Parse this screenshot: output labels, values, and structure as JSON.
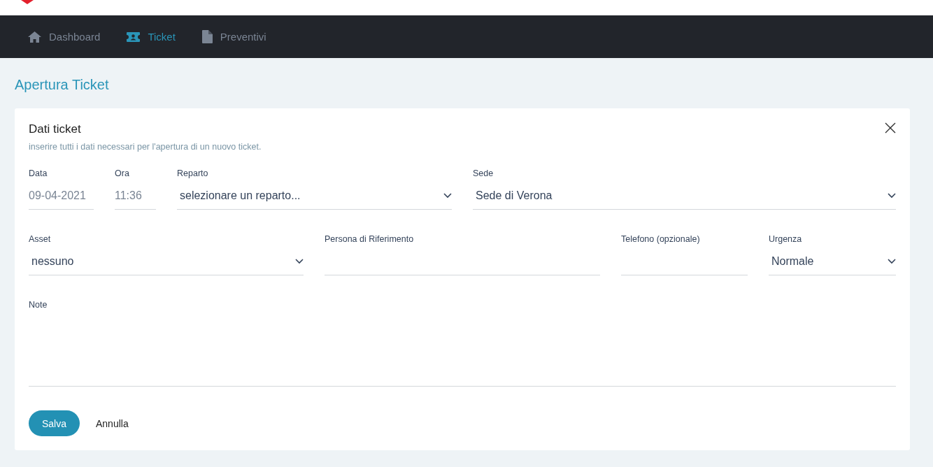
{
  "nav": [
    {
      "label": "Dashboard",
      "selected": false
    },
    {
      "label": "Ticket",
      "selected": true
    },
    {
      "label": "Preventivi",
      "selected": false
    }
  ],
  "page_title": "Apertura Ticket",
  "card": {
    "title": "Dati ticket",
    "subtitle": "inserire tutti i dati necessari per l'apertura di un nuovo ticket.",
    "rows": [
      [
        {
          "label": "Data",
          "kind": "text",
          "value": "09-04-2021",
          "readonly": true
        },
        {
          "label": "Ora",
          "kind": "text",
          "value": "11:36",
          "readonly": true
        },
        {
          "label": "Reparto",
          "kind": "select",
          "value": "selezionare un reparto..."
        },
        {
          "label": "Sede",
          "kind": "select",
          "value": "Sede di Verona"
        }
      ],
      [
        {
          "label": "Asset",
          "kind": "select",
          "value": "nessuno"
        },
        {
          "label": "Persona di Riferimento",
          "kind": "text"
        },
        {
          "label": "Telefono (opzionale)",
          "kind": "text"
        },
        {
          "label": "Urgenza",
          "kind": "select",
          "value": "Normale"
        }
      ],
      [
        {
          "label": "Note",
          "kind": "textarea"
        }
      ]
    ],
    "buttons": [
      {
        "label": "Salva",
        "kind": "primary"
      },
      {
        "label": "Annulla",
        "kind": "plain"
      }
    ]
  }
}
